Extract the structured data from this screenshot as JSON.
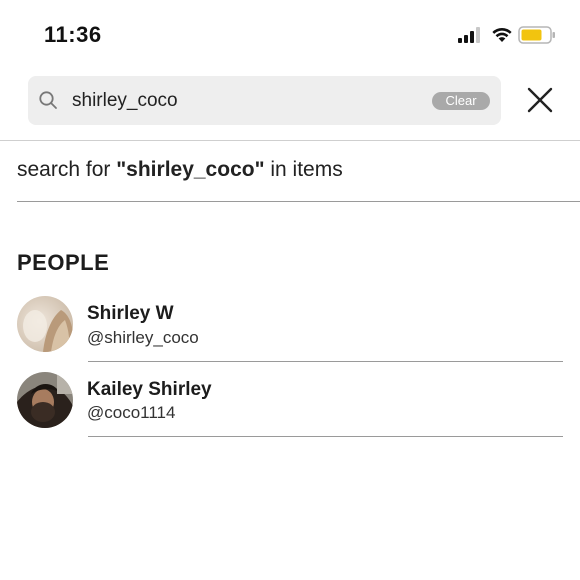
{
  "status_bar": {
    "time": "11:36",
    "battery_color": "#f2c40f"
  },
  "search": {
    "value": "shirley_coco",
    "clear_label": "Clear"
  },
  "search_for": {
    "prefix": "search for ",
    "query": "\"shirley_coco\"",
    "suffix": " in items"
  },
  "people": {
    "section_title": "PEOPLE",
    "items": [
      {
        "name": "Shirley W",
        "handle": "@shirley_coco"
      },
      {
        "name": "Kailey Shirley",
        "handle": "@coco1114"
      }
    ]
  }
}
